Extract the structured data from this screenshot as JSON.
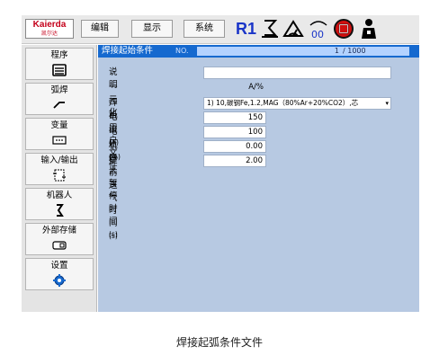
{
  "header": {
    "logo_brand": "Kaierda",
    "logo_sub": "凯尔达",
    "menu_edit": "编辑",
    "menu_display": "显示",
    "menu_system": "系统",
    "robot_id": "R1",
    "accent_color": "#1a35c8"
  },
  "sidebar": {
    "items": [
      {
        "label": "程序",
        "icon": "program-icon"
      },
      {
        "label": "弧焊",
        "icon": "torch-icon"
      },
      {
        "label": "变量",
        "icon": "variable-icon"
      },
      {
        "label": "输入/输出",
        "icon": "io-icon"
      },
      {
        "label": "机器人",
        "icon": "robot-icon"
      },
      {
        "label": "外部存储",
        "icon": "storage-icon"
      },
      {
        "label": "设置",
        "icon": "gear-icon"
      }
    ]
  },
  "main": {
    "title": "焊接起始条件",
    "no_label": "NO.",
    "current": "1",
    "total": "/ 1000",
    "rows": [
      {
        "label": "说明",
        "unit": "",
        "value": ""
      },
      {
        "label": "一元化",
        "unit": "",
        "value": "A/%"
      },
      {
        "label": "焊机用户文件",
        "unit": "",
        "value": "1) 10,碳钢Fe,1.2,MAG（80%Ar+20%CO2）,芯"
      },
      {
        "label": "电流",
        "unit": "(A)",
        "value": "150"
      },
      {
        "label": "电压",
        "unit": "(%)",
        "value": "100"
      },
      {
        "label": "机器人暂停时间",
        "unit": "(s)",
        "value": "0.00"
      },
      {
        "label": "提前送气时间",
        "unit": "(s)",
        "value": "2.00"
      }
    ]
  },
  "caption": "焊接起弧条件文件"
}
